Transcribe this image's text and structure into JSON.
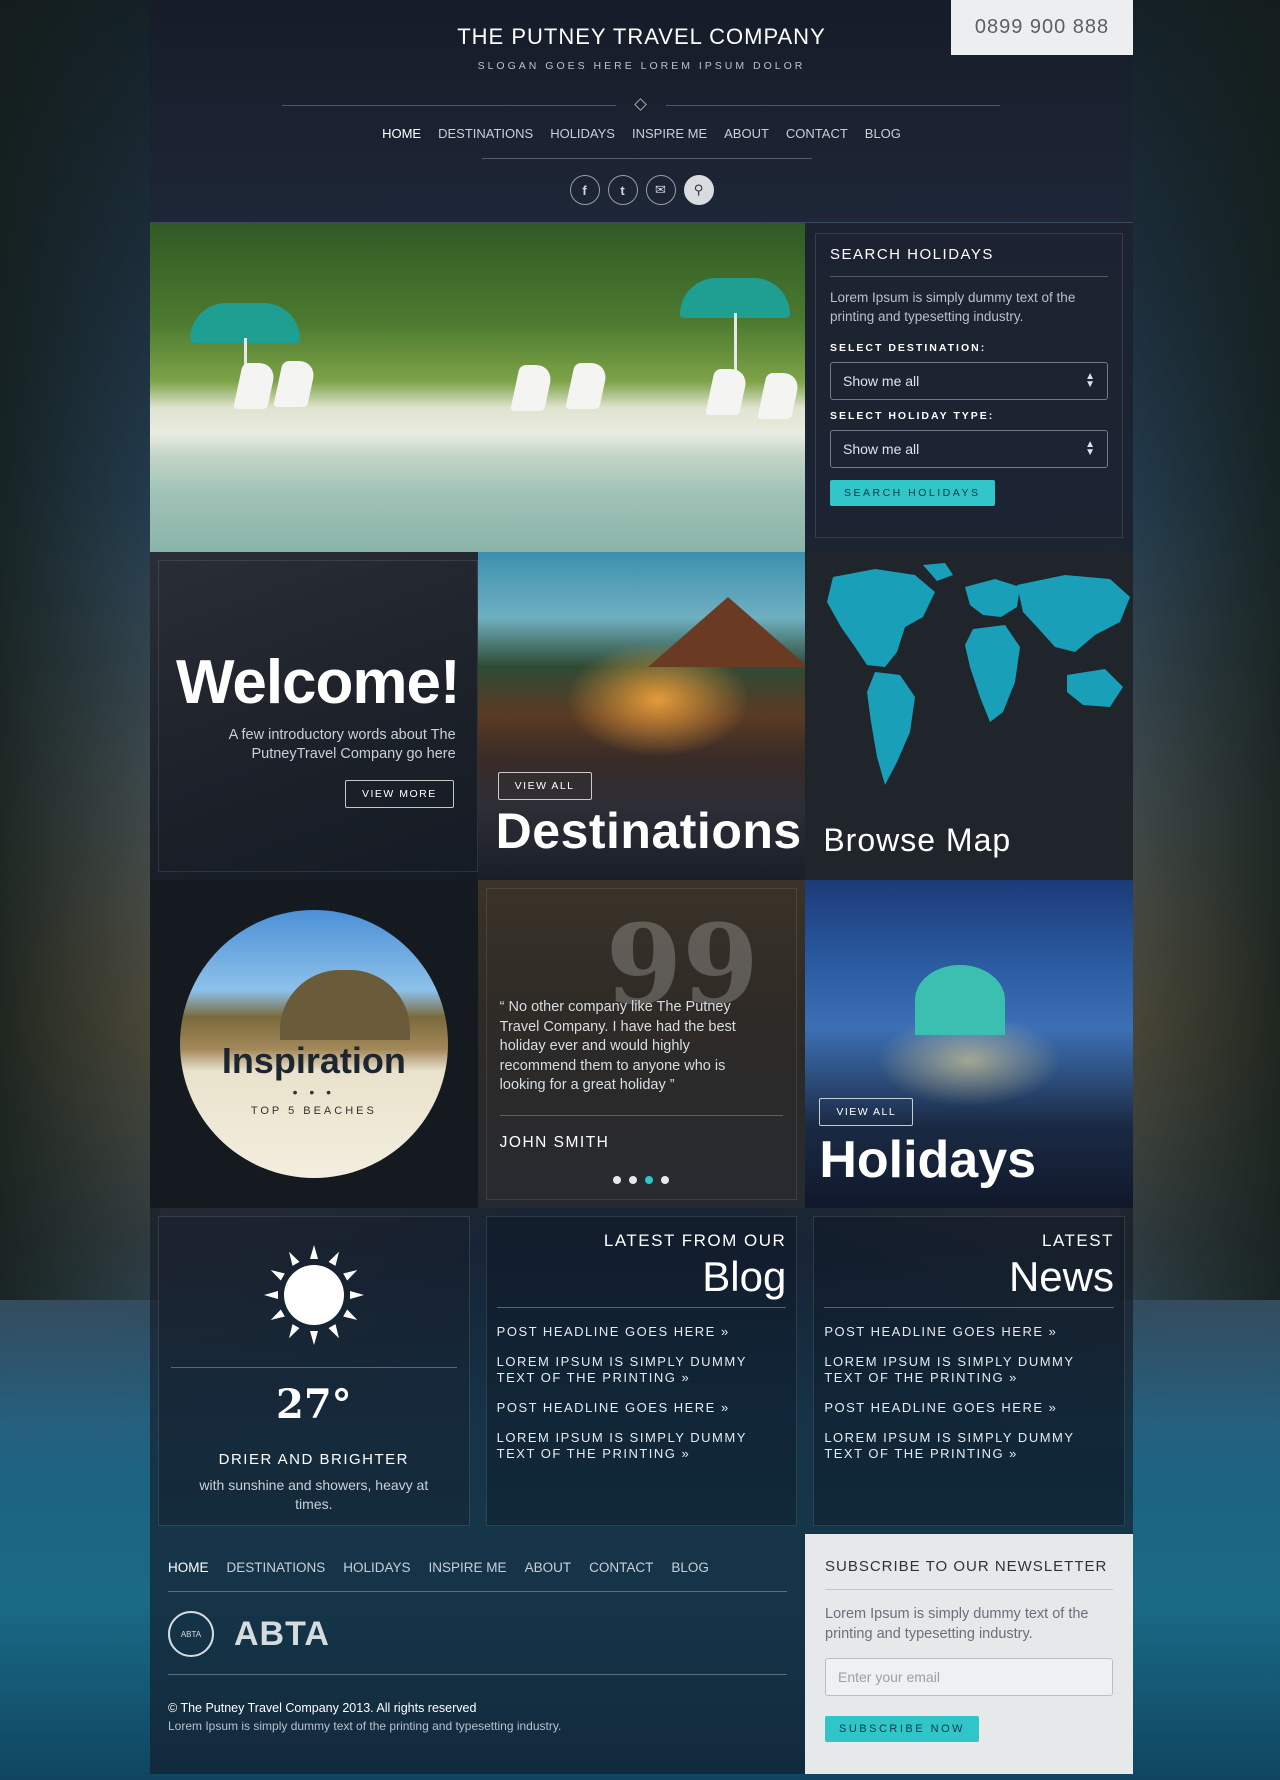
{
  "header": {
    "brand": "THE PUTNEY TRAVEL COMPANY",
    "slogan": "SLOGAN GOES HERE LOREM IPSUM DOLOR",
    "phone": "0899 900 888",
    "nav": [
      "HOME",
      "DESTINATIONS",
      "HOLIDAYS",
      "INSPIRE ME",
      "ABOUT",
      "CONTACT",
      "BLOG"
    ],
    "social_icons": [
      "facebook-icon",
      "twitter-icon",
      "email-icon",
      "search-icon"
    ]
  },
  "search": {
    "title": "SEARCH HOLIDAYS",
    "text": "Lorem Ipsum is simply dummy text of the printing and typesetting industry.",
    "destination_label": "SELECT DESTINATION:",
    "destination_value": "Show me all",
    "type_label": "SELECT HOLIDAY TYPE:",
    "type_value": "Show me all",
    "button": "SEARCH HOLIDAYS"
  },
  "welcome": {
    "title": "Welcome!",
    "text": "A few introductory words about The PutneyTravel Company go here",
    "button": "VIEW MORE"
  },
  "destinations": {
    "button": "VIEW ALL",
    "title": "Destinations"
  },
  "map": {
    "title": "Browse Map"
  },
  "inspiration": {
    "title": "Inspiration",
    "dots": "• • •",
    "subtitle": "TOP 5 BEACHES"
  },
  "testimonial": {
    "quote_mark": "99",
    "text": "“ No other company like The Putney Travel Company.  I have had the best holiday ever and would highly recommend them to anyone who is looking for a great holiday ”",
    "name": "JOHN SMITH",
    "active_slide": 3,
    "slide_count": 4
  },
  "holidays": {
    "button": "VIEW ALL",
    "title": "Holidays"
  },
  "weather": {
    "temperature": "27°",
    "title": "DRIER AND BRIGHTER",
    "text": "with sunshine and showers, heavy at times."
  },
  "blog": {
    "kicker": "LATEST FROM OUR",
    "title": "Blog",
    "items": [
      "POST HEADLINE GOES HERE »",
      "LOREM IPSUM IS SIMPLY DUMMY TEXT OF THE PRINTING »",
      "POST HEADLINE GOES HERE »",
      "LOREM IPSUM IS SIMPLY DUMMY TEXT OF THE PRINTING »"
    ]
  },
  "news": {
    "kicker": "LATEST",
    "title": "News",
    "items": [
      "POST HEADLINE GOES HERE »",
      "LOREM IPSUM IS SIMPLY DUMMY TEXT OF THE PRINTING »",
      "POST HEADLINE GOES HERE »",
      "LOREM IPSUM IS SIMPLY DUMMY TEXT OF THE PRINTING »"
    ]
  },
  "footer": {
    "nav": [
      "HOME",
      "DESTINATIONS",
      "HOLIDAYS",
      "INSPIRE ME",
      "ABOUT",
      "CONTACT",
      "BLOG"
    ],
    "abta_seal": "ABTA PROTECTED",
    "abta_word": "ABTA",
    "copyright": "© The Putney Travel Company 2013. All rights reserved",
    "tagline": "Lorem Ipsum is simply dummy text of the printing and typesetting industry."
  },
  "newsletter": {
    "title": "SUBSCRIBE TO OUR NEWSLETTER",
    "text": "Lorem Ipsum is simply dummy text of the printing and typesetting industry.",
    "placeholder": "Enter your email",
    "button": "SUBSCRIBE NOW"
  },
  "colors": {
    "accent": "#2fc5c9",
    "map_land": "#1a9fb8",
    "panel": "#1c2230"
  }
}
